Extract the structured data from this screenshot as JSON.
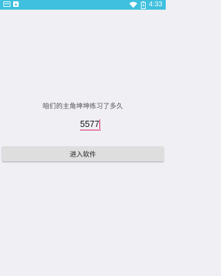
{
  "status_bar": {
    "time": "4:33",
    "icons": [
      "notification-icon",
      "image-icon",
      "wifi-icon",
      "battery-icon"
    ]
  },
  "main": {
    "question": "咱们的主角坤坤练习了多久",
    "answer_value": "5577",
    "enter_button_label": "进入软件"
  },
  "colors": {
    "status_bar": "#3ec0de",
    "background": "#efeff4",
    "accent": "#d81b60",
    "button": "#dedede"
  }
}
